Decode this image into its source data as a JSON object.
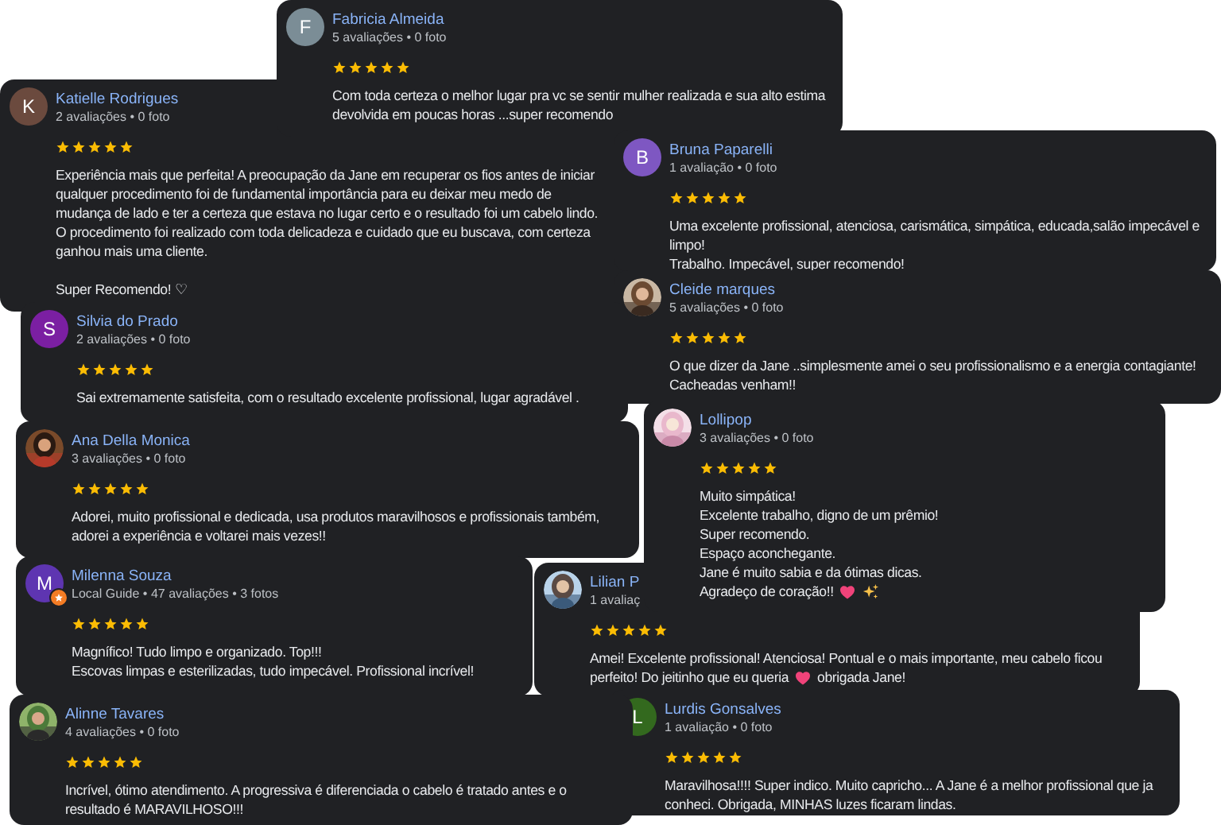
{
  "reviews": [
    {
      "name": "Fabricia Almeida",
      "meta": "5 avaliações • 0 foto",
      "avatar": {
        "kind": "letter",
        "letter": "F",
        "color": "#7b8d96"
      },
      "stars": 5,
      "paragraphs": [
        {
          "lines": [
            {
              "text": "Com toda certeza o melhor lugar pra vc se sentir mulher realizada e sua alto estima"
            },
            {
              "text": "devolvida em poucas horas ...super recomendo"
            }
          ]
        }
      ]
    },
    {
      "name": "Katielle Rodrigues",
      "meta": "2 avaliações • 0 foto",
      "avatar": {
        "kind": "letter",
        "letter": "K",
        "color": "#6b4a3e"
      },
      "stars": 5,
      "paragraphs": [
        {
          "lines": [
            {
              "text": "Experiência mais que perfeita! A preocupação da Jane em recuperar os fios antes de iniciar"
            },
            {
              "text": "qualquer procedimento foi de fundamental importância para eu deixar meu medo de"
            },
            {
              "text": "mudança de lado e ter a certeza que estava no lugar certo e o resultado foi um cabelo lindo."
            },
            {
              "text": "O procedimento foi realizado com toda delicadeza e cuidado que eu buscava, com certeza"
            },
            {
              "text": "ganhou mais uma cliente."
            }
          ]
        },
        {
          "lines": [
            {
              "text": "Super Recomendo! ♡"
            }
          ]
        }
      ]
    },
    {
      "name": "Bruna Paparelli",
      "meta": "1 avaliação • 0 foto",
      "avatar": {
        "kind": "letter",
        "letter": "B",
        "color": "#7e57c2"
      },
      "stars": 5,
      "paragraphs": [
        {
          "lines": [
            {
              "text": "Uma excelente profissional, atenciosa, carismática, simpática, educada,salão impecável e"
            },
            {
              "text": "limpo!"
            },
            {
              "text": "Trabalho. Impecável, super recomendo!"
            }
          ]
        }
      ]
    },
    {
      "name": "Cleide marques",
      "meta": "5 avaliações • 0 foto",
      "avatar": {
        "kind": "picture"
      },
      "stars": 5,
      "paragraphs": [
        {
          "lines": [
            {
              "text": "O que dizer da Jane ..simplesmente amei o seu profissionalismo e a energia contagiante!"
            },
            {
              "text": "Cacheadas venham!!"
            }
          ]
        }
      ]
    },
    {
      "name": "Silvia do Prado",
      "meta": "2 avaliações • 0 foto",
      "avatar": {
        "kind": "letter",
        "letter": "S",
        "color": "#7b1fa2"
      },
      "stars": 5,
      "paragraphs": [
        {
          "lines": [
            {
              "text": "Sai extremamente satisfeita, com o resultado excelente profissional, lugar agradável ."
            }
          ]
        }
      ]
    },
    {
      "name": "Ana Della Monica",
      "meta": "3 avaliações • 0 foto",
      "avatar": {
        "kind": "picture"
      },
      "stars": 5,
      "paragraphs": [
        {
          "lines": [
            {
              "text": "Adorei, muito profissional e dedicada, usa produtos maravilhosos e profissionais também,"
            },
            {
              "text": "adorei a experiência e voltarei mais vezes!!"
            }
          ]
        }
      ]
    },
    {
      "name": "Lollipop",
      "meta": "3 avaliações • 0 foto",
      "avatar": {
        "kind": "picture"
      },
      "stars": 5,
      "paragraphs": [
        {
          "lines": [
            {
              "text": "Muito simpática!"
            },
            {
              "text": "Excelente trabalho, digno de um prêmio!"
            },
            {
              "text": "Super recomendo."
            },
            {
              "text": "Espaço aconchegante."
            },
            {
              "text": "Jane é muito sabia e da ótimas dicas."
            },
            {
              "parts": [
                {
                  "kind": "text",
                  "text": "Agradeço de coração!!"
                },
                {
                  "kind": "heart"
                },
                {
                  "kind": "sparkle"
                }
              ]
            }
          ]
        }
      ]
    },
    {
      "name": "Milenna Souza",
      "meta": "Local Guide • 47 avaliações • 3 fotos",
      "avatar": {
        "kind": "letter",
        "letter": "M",
        "color": "#5e35b1",
        "local_guide": true
      },
      "stars": 5,
      "paragraphs": [
        {
          "lines": [
            {
              "text": "Magnífico! Tudo limpo e organizado. Top!!!"
            },
            {
              "text": "Escovas limpas e esterilizadas, tudo impecável. Profissional incrível!"
            }
          ]
        }
      ]
    },
    {
      "name": "Lilian P",
      "meta": "1 avaliaç",
      "avatar": {
        "kind": "picture"
      },
      "stars": 5,
      "paragraphs": [
        {
          "lines": [
            {
              "text": "Amei! Excelente profissional! Atenciosa! Pontual e o mais importante, meu cabelo ficou"
            },
            {
              "parts": [
                {
                  "kind": "text",
                  "text": "perfeito! Do jeitinho que eu queria"
                },
                {
                  "kind": "heart"
                },
                {
                  "kind": "text",
                  "text": "obrigada Jane!"
                }
              ]
            }
          ]
        }
      ]
    },
    {
      "name": "Alinne Tavares",
      "meta": "4 avaliações • 0 foto",
      "avatar": {
        "kind": "picture"
      },
      "stars": 5,
      "paragraphs": [
        {
          "lines": [
            {
              "text": "Incrível, ótimo atendimento. A progressiva é diferenciada o cabelo é tratado antes e o"
            },
            {
              "text": "resultado é MARAVILHOSO!!!"
            }
          ]
        }
      ]
    },
    {
      "name": "Lurdis Gonsalves",
      "meta": "1 avaliação • 0 foto",
      "avatar": {
        "kind": "letter",
        "letter": "L",
        "color": "#33691e"
      },
      "stars": 5,
      "paragraphs": [
        {
          "lines": [
            {
              "text": "Maravilhosa!!!! Super indico. Muito capricho... A Jane é a melhor profissional que ja"
            },
            {
              "text": "conheci. Obrigada, MINHAS luzes ficaram lindas."
            }
          ]
        }
      ]
    }
  ]
}
